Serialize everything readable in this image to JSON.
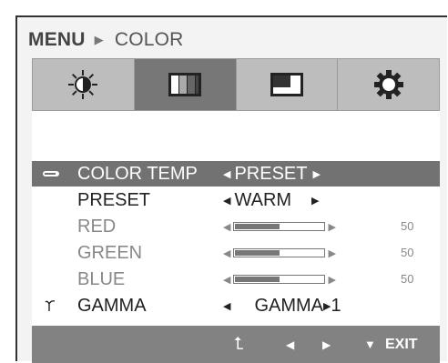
{
  "breadcrumb": {
    "menu": "MENU",
    "separator": "▶",
    "current": "COLOR"
  },
  "tabs": [
    {
      "icon": "brightness-icon"
    },
    {
      "icon": "color-bars-icon",
      "active": true
    },
    {
      "icon": "screen-position-icon"
    },
    {
      "icon": "settings-gear-icon"
    }
  ],
  "rows": {
    "color_temp": {
      "label": "COLOR TEMP",
      "left": "◀",
      "value": "PRESET",
      "right": "▶"
    },
    "preset": {
      "label": "PRESET",
      "left": "◀",
      "value": "WARM",
      "right": "▶"
    },
    "red": {
      "label": "RED",
      "left": "◀",
      "right": "▶",
      "value": 50,
      "value_text": "50"
    },
    "green": {
      "label": "GREEN",
      "left": "◀",
      "right": "▶",
      "value": 50,
      "value_text": "50"
    },
    "blue": {
      "label": "BLUE",
      "left": "◀",
      "right": "▶",
      "value": 50,
      "value_text": "50"
    },
    "gamma": {
      "label": "GAMMA",
      "left": "◀",
      "value": "GAMMA",
      "right": "▶",
      "suffix": "1"
    }
  },
  "footer": {
    "up": "⮤",
    "left": "◀",
    "right": "▶",
    "down": "▼",
    "exit": "EXIT"
  },
  "colors": {
    "accent_selected": "#727272",
    "tab_active": "#777777",
    "tab_inactive": "#bdbdbd",
    "footer": "#828282"
  }
}
